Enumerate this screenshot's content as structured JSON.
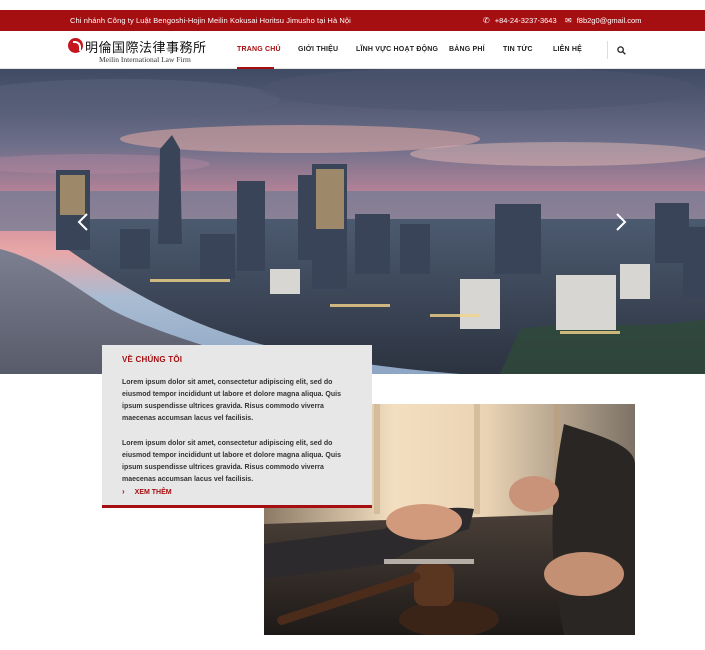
{
  "topbar": {
    "branch": "Chi nhánh Công ty Luật Bengoshi-Hojin Meilin Kokusai Horitsu Jimusho tại Hà Nội",
    "phone": "+84-24-3237-3643",
    "email": "f8b2g0@gmail.com",
    "phone_icon": "phone-icon",
    "email_icon": "envelope-icon"
  },
  "logo": {
    "japanese": "明倫国際法律事務所",
    "english": "Meilin International Law Firm"
  },
  "nav": {
    "items": [
      {
        "label": "TRANG CHỦ",
        "active": true
      },
      {
        "label": "GIỚI THIỆU",
        "active": false
      },
      {
        "label": "LĨNH VỰC HOẠT ĐỘNG",
        "active": false
      },
      {
        "label": "BẢNG PHÍ",
        "active": false
      },
      {
        "label": "TIN TỨC",
        "active": false
      },
      {
        "label": "LIÊN HỆ",
        "active": false
      }
    ],
    "search_icon": "search-icon"
  },
  "hero": {
    "prev_icon": "chevron-left-icon",
    "next_icon": "chevron-right-icon"
  },
  "about": {
    "title": "VỀ CHÚNG TÔI",
    "paragraph1": "Lorem ipsum dolor sit amet, consectetur adipiscing elit, sed do eiusmod tempor incididunt ut labore et dolore magna aliqua. Quis ipsum suspendisse ultrices gravida. Risus commodo viverra maecenas accumsan lacus vel facilisis.",
    "paragraph2": "Lorem ipsum dolor sit amet, consectetur adipiscing elit, sed do eiusmod tempor incididunt ut labore et dolore magna aliqua. Quis ipsum suspendisse ultrices gravida. Risus commodo viverra maecenas accumsan lacus vel facilisis.",
    "more_label": "XEM THÊM"
  },
  "colors": {
    "brand_red": "#a50f12",
    "panel_grey": "#e7e7e7"
  }
}
